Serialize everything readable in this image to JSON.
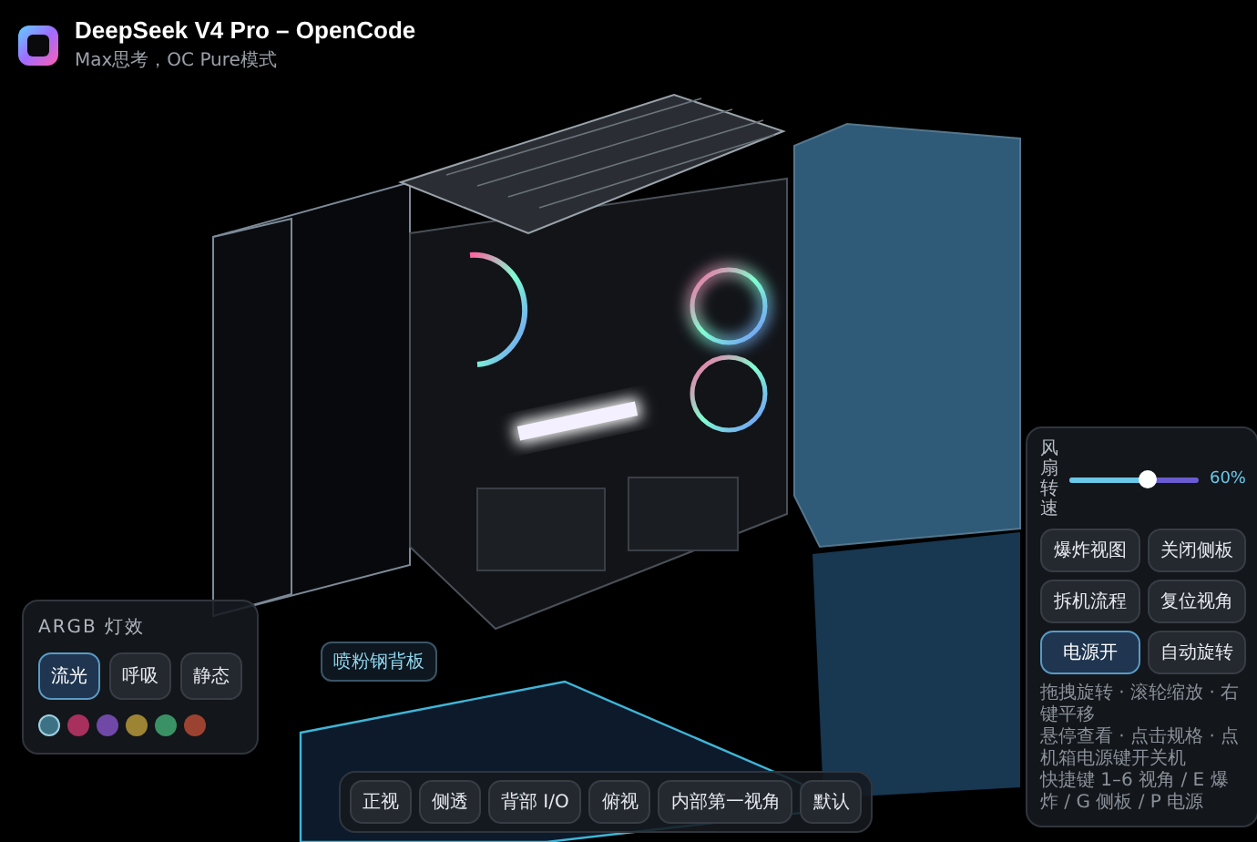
{
  "app": {
    "title": "DeepSeek V4 Pro – OpenCode",
    "subtitle": "Max思考，OC Pure模式"
  },
  "argb_panel": {
    "title": "ARGB 灯效",
    "modes": [
      {
        "label": "流光",
        "selected": true
      },
      {
        "label": "呼吸",
        "selected": false
      },
      {
        "label": "静态",
        "selected": false
      }
    ],
    "swatches": [
      {
        "color": "#3d7285",
        "selected": true
      },
      {
        "color": "#a8305c",
        "selected": false
      },
      {
        "color": "#7048a8",
        "selected": false
      },
      {
        "color": "#9c8434",
        "selected": false
      },
      {
        "color": "#3a9264",
        "selected": false
      },
      {
        "color": "#9c4230",
        "selected": false
      }
    ]
  },
  "part_label": "喷粉钢背板",
  "control_panel": {
    "fan": {
      "label": "风扇转速",
      "level": 0.6,
      "reading": "60%"
    },
    "buttons": [
      {
        "label": "爆炸视图",
        "selected": false
      },
      {
        "label": "关闭侧板",
        "selected": false
      },
      {
        "label": "拆机流程",
        "selected": false
      },
      {
        "label": "复位视角",
        "selected": false
      },
      {
        "label": "电源开",
        "selected": true
      },
      {
        "label": "自动旋转",
        "selected": false
      }
    ],
    "help": [
      "拖拽旋转 · 滚轮缩放 · 右键平移",
      "悬停查看 · 点击规格 · 点机箱电源键开关机",
      "快捷键 1–6 视角 / E 爆炸 / G 侧板 / P 电源"
    ]
  },
  "view_bar": [
    "正视",
    "侧透",
    "背部 I/O",
    "俯视",
    "内部第一视角",
    "默认"
  ]
}
